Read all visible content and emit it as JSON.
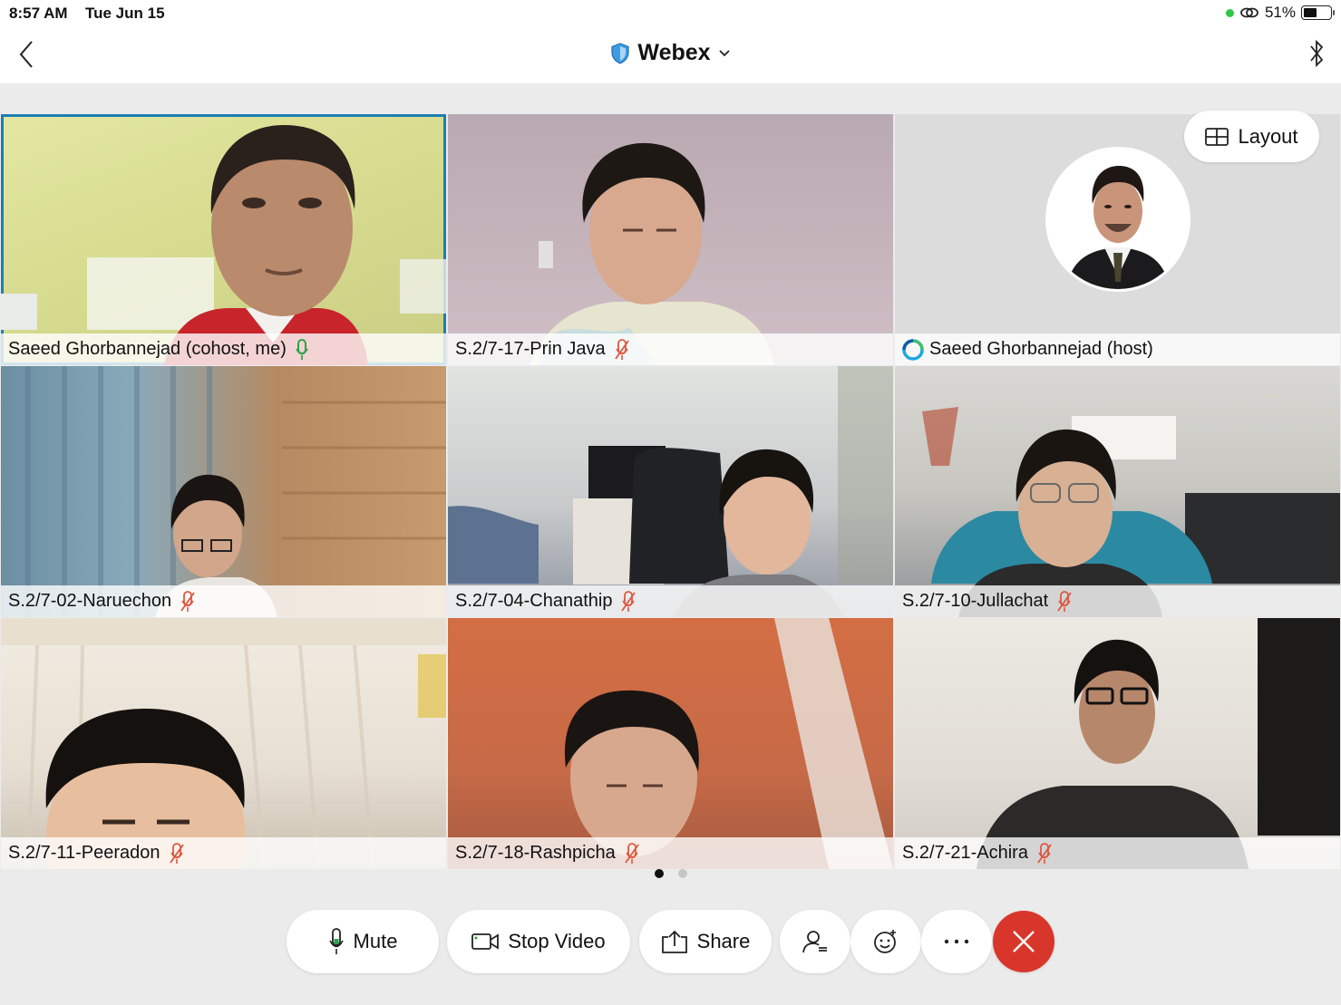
{
  "status_bar": {
    "time": "8:57 AM",
    "date": "Tue Jun 15",
    "battery": "51%"
  },
  "header": {
    "title": "Webex"
  },
  "layout_button": {
    "label": "Layout"
  },
  "participants": [
    {
      "name": "Saeed Ghorbannejad (cohost, me)",
      "mic": "on"
    },
    {
      "name": "S.2/7-17-Prin Java",
      "mic": "muted"
    },
    {
      "name": "Saeed Ghorbannejad (host)",
      "mic": "host"
    },
    {
      "name": "S.2/7-02-Naruechon",
      "mic": "muted"
    },
    {
      "name": "S.2/7-04-Chanathip",
      "mic": "muted"
    },
    {
      "name": "S.2/7-10-Jullachat",
      "mic": "muted"
    },
    {
      "name": "S.2/7-11-Peeradon",
      "mic": "muted"
    },
    {
      "name": "S.2/7-18-Rashpicha",
      "mic": "muted"
    },
    {
      "name": "S.2/7-21-Achira",
      "mic": "muted"
    }
  ],
  "pager": {
    "pages": 2,
    "current": 1
  },
  "controls": {
    "mute": "Mute",
    "stop_video": "Stop Video",
    "share": "Share"
  },
  "colors": {
    "accent": "#1a7fb5",
    "muted_mic": "#e0563f",
    "live_mic": "#2aa34a",
    "end_call": "#d9362b"
  }
}
